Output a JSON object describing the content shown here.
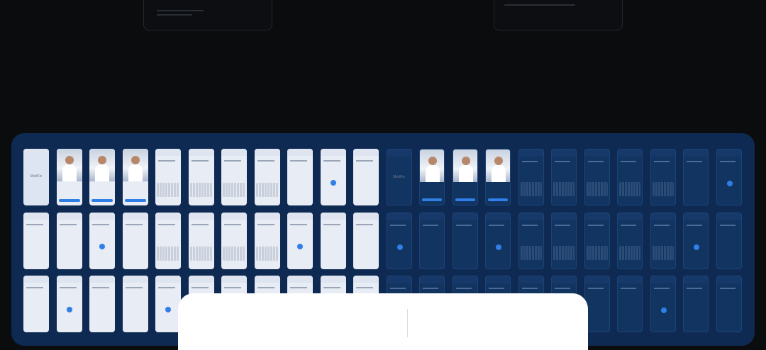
{
  "brand_label": "MedFix",
  "colors": {
    "page_bg": "#0b0c0e",
    "showcase_bg": "#0f2a52",
    "accent": "#2f7fe6",
    "light_screen": "#e8ecf4",
    "dark_screen": "#123461"
  },
  "showcase": {
    "rows": 3,
    "columns": 22,
    "themes": [
      "light",
      "dark"
    ]
  }
}
